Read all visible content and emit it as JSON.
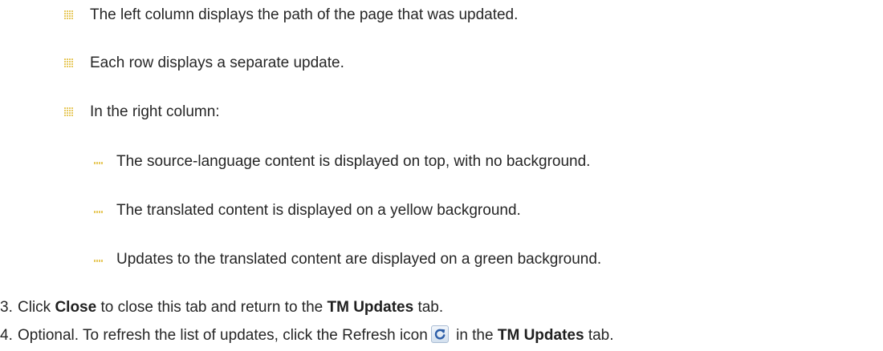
{
  "bullets_l2": [
    "The left column displays the path of the page that was updated.",
    "Each row displays a separate update.",
    "In the right column:"
  ],
  "bullets_l3": [
    "The source-language content is displayed on top, with no background.",
    "The translated content is displayed on a yellow background.",
    "Updates to the translated content are displayed on a green background."
  ],
  "step3": {
    "number": "3.",
    "text_a": "Click ",
    "bold_a": "Close",
    "text_b": " to close this tab and return to the ",
    "bold_b": "TM Updates",
    "text_c": " tab."
  },
  "step4": {
    "number": "4.",
    "text_a": "Optional. To refresh the list of updates, click the Refresh icon",
    "text_b": " in the ",
    "bold_b": "TM Updates",
    "text_c": " tab."
  },
  "colors": {
    "bullet": "#e7c95e",
    "text": "#262626",
    "icon_blue": "#2d5ea8"
  }
}
